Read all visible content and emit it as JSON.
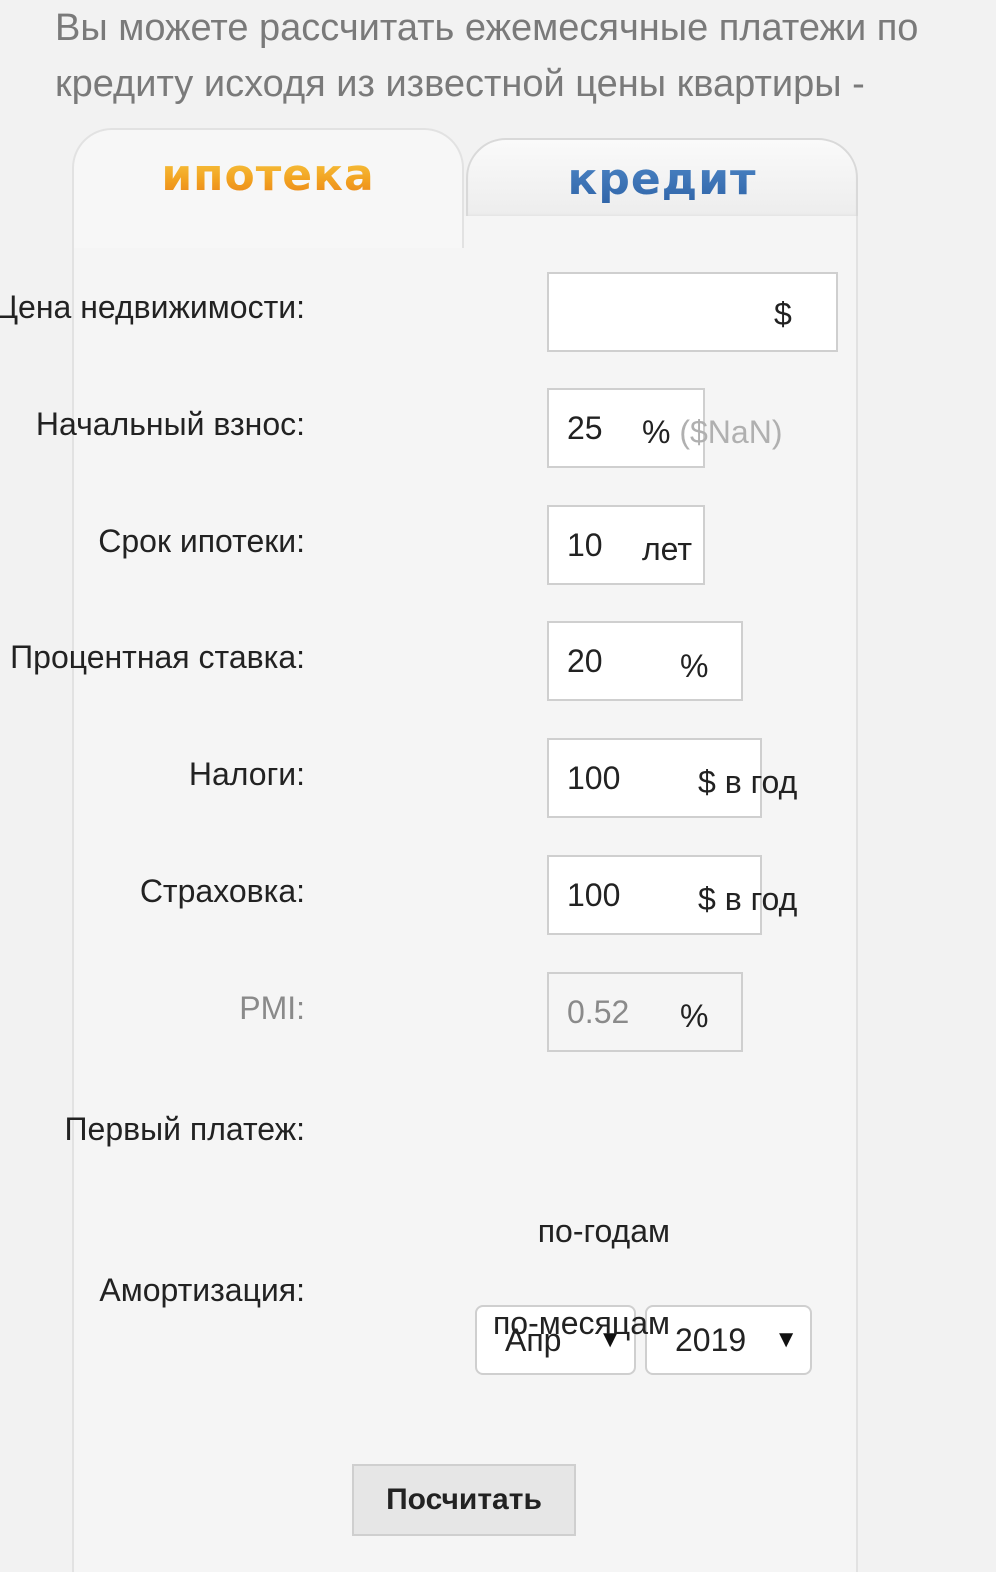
{
  "intro": {
    "text": "Вы можете рассчитать ежемесячные платежи по кредиту исходя из известной цены квартиры -"
  },
  "tabs": [
    {
      "label": "ипотека",
      "active": true,
      "color": "#f2a120"
    },
    {
      "label": "кредит",
      "active": false,
      "color": "#2f64a8"
    }
  ],
  "form": {
    "price": {
      "label": "Цена недвижимости:",
      "value": "",
      "unit": "$"
    },
    "down_payment": {
      "label": "Начальный взнос:",
      "value": "25",
      "unit": "%",
      "hint": "($NaN)"
    },
    "term": {
      "label": "Срок ипотеки:",
      "value": "10",
      "unit": "лет"
    },
    "rate": {
      "label": "Процентная ставка:",
      "value": "20",
      "unit": "%"
    },
    "taxes": {
      "label": "Налоги:",
      "value": "100",
      "unit": "$ в год"
    },
    "insurance": {
      "label": "Страховка:",
      "value": "100",
      "unit": "$ в год"
    },
    "pmi": {
      "label": "PMI:",
      "value": "0.52",
      "unit": "%"
    },
    "first_payment": {
      "label": "Первый платеж:",
      "month": "Апр",
      "year": "2019",
      "caret": "▼"
    },
    "amortization": {
      "label": "Амортизация:",
      "by_years": "по-годам",
      "by_months": "по-месяцам"
    },
    "submit_label": "Посчитать"
  }
}
